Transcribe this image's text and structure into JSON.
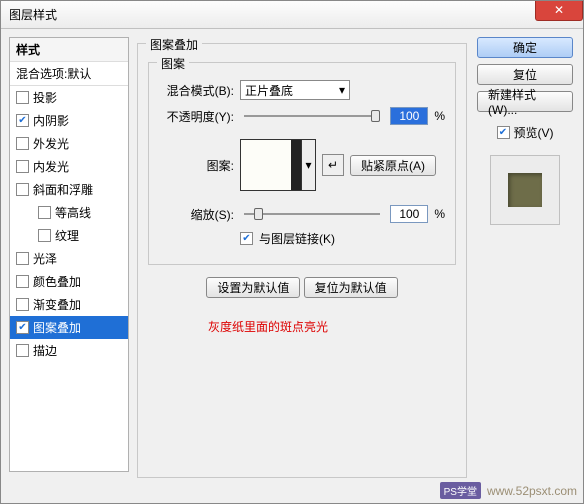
{
  "title": "图层样式",
  "close_glyph": "✕",
  "styles": {
    "header": "样式",
    "subheader": "混合选项:默认",
    "items": [
      {
        "label": "投影",
        "checked": false,
        "indent": false,
        "selected": false
      },
      {
        "label": "内阴影",
        "checked": true,
        "indent": false,
        "selected": false
      },
      {
        "label": "外发光",
        "checked": false,
        "indent": false,
        "selected": false
      },
      {
        "label": "内发光",
        "checked": false,
        "indent": false,
        "selected": false
      },
      {
        "label": "斜面和浮雕",
        "checked": false,
        "indent": false,
        "selected": false
      },
      {
        "label": "等高线",
        "checked": false,
        "indent": true,
        "selected": false
      },
      {
        "label": "纹理",
        "checked": false,
        "indent": true,
        "selected": false
      },
      {
        "label": "光泽",
        "checked": false,
        "indent": false,
        "selected": false
      },
      {
        "label": "颜色叠加",
        "checked": false,
        "indent": false,
        "selected": false
      },
      {
        "label": "渐变叠加",
        "checked": false,
        "indent": false,
        "selected": false
      },
      {
        "label": "图案叠加",
        "checked": true,
        "indent": false,
        "selected": true
      },
      {
        "label": "描边",
        "checked": false,
        "indent": false,
        "selected": false
      }
    ]
  },
  "main": {
    "outer_title": "图案叠加",
    "inner_title": "图案",
    "blend_label": "混合模式(B):",
    "blend_value": "正片叠底",
    "opacity_label": "不透明度(Y):",
    "opacity_value": "100",
    "percent": "%",
    "pattern_label": "图案:",
    "swatch_menu_glyph": "▾",
    "new_swatch_icon": "↵",
    "snap_btn": "贴紧原点(A)",
    "scale_label": "缩放(S):",
    "scale_value": "100",
    "link_label": "与图层链接(K)",
    "default_set": "设置为默认值",
    "default_reset": "复位为默认值",
    "note": "灰度纸里面的斑点亮光"
  },
  "right": {
    "ok": "确定",
    "cancel": "复位",
    "new_style": "新建样式(W)...",
    "preview_label": "预览(V)"
  },
  "watermark": {
    "badge": "PS学堂",
    "url": "www.52psxt.com"
  }
}
